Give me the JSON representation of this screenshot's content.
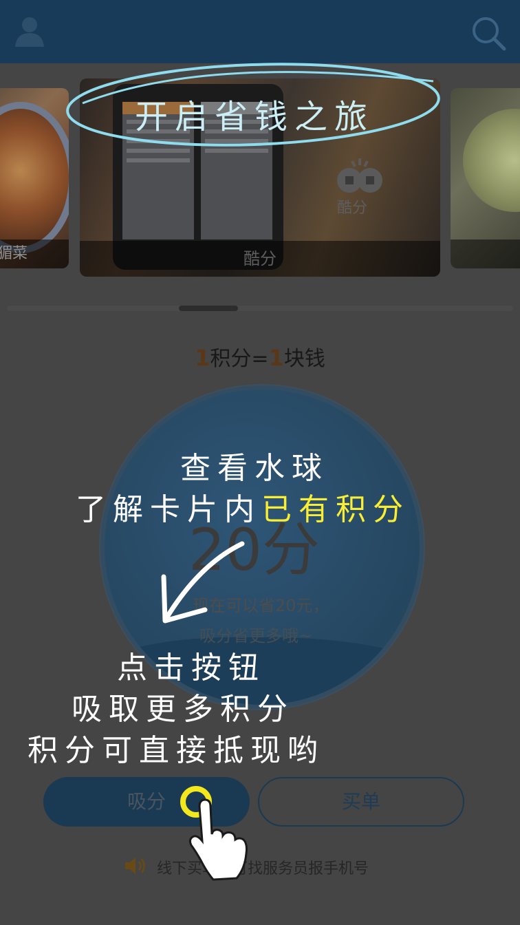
{
  "header": {
    "avatar_icon": "avatar-icon",
    "search_icon": "search-icon"
  },
  "carousel": {
    "left_card_label": "猸菜",
    "center_card_label": "酷分",
    "center_coins_label": "酷分",
    "banner": "开启省钱之旅"
  },
  "rate": {
    "num1": "1",
    "mid": "积分=",
    "num2": "1",
    "tail": "块钱"
  },
  "water_ball": {
    "value": "20分",
    "line1": "现在可以省20元，",
    "line2": "吸分省更多哦~"
  },
  "buttons": {
    "absorb": "吸分",
    "pay": "买单"
  },
  "tip": {
    "text": "线下买单时可找服务员报手机号"
  },
  "tutorial": {
    "line1": "查看水球",
    "line2_a": "了解卡片内",
    "line2_b": "已有积分",
    "line3": "点击按钮",
    "line4": "吸取更多积分",
    "line5": "积分可直接抵现哟"
  },
  "colors": {
    "header": "#173b58",
    "highlight": "#f9ee34",
    "accent_number": "#5a3716"
  }
}
